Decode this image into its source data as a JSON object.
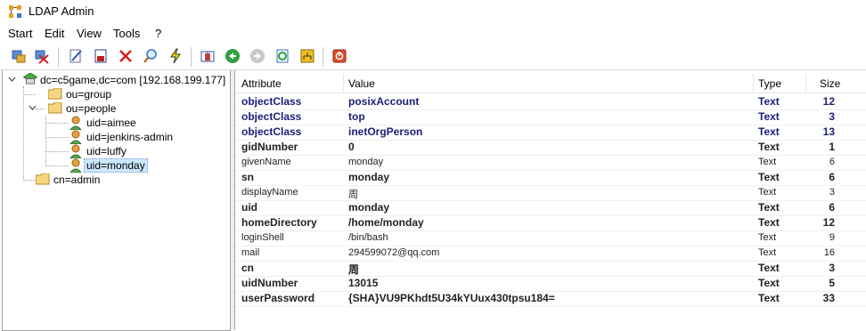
{
  "window": {
    "title": "LDAP Admin"
  },
  "menu": [
    "Start",
    "Edit",
    "View",
    "Tools",
    "?"
  ],
  "toolbar": {
    "icons": [
      "connect-icon",
      "disconnect-icon",
      "edit-entry-icon",
      "save-icon",
      "delete-icon",
      "search-icon",
      "lightning-icon",
      "book-icon",
      "back-icon",
      "forward-icon",
      "refresh-icon",
      "schema-icon",
      "exit-icon"
    ]
  },
  "tree": {
    "root": "dc=c5game,dc=com [192.168.199.177]",
    "group": "ou=group",
    "people": "ou=people",
    "users": [
      "uid=aimee",
      "uid=jenkins-admin",
      "uid=luffy",
      "uid=monday"
    ],
    "selected": "uid=monday",
    "admin": "cn=admin"
  },
  "grid": {
    "headers": {
      "attribute": "Attribute",
      "value": "Value",
      "type": "Type",
      "size": "Size"
    },
    "rows": [
      {
        "attribute": "objectClass",
        "value": "posixAccount",
        "type": "Text",
        "size": "12"
      },
      {
        "attribute": "objectClass",
        "value": "top",
        "type": "Text",
        "size": "3"
      },
      {
        "attribute": "objectClass",
        "value": "inetOrgPerson",
        "type": "Text",
        "size": "13"
      },
      {
        "attribute": "gidNumber",
        "value": "0",
        "type": "Text",
        "size": "1"
      },
      {
        "attribute": "givenName",
        "value": "monday",
        "type": "Text",
        "size": "6"
      },
      {
        "attribute": "sn",
        "value": "monday",
        "type": "Text",
        "size": "6"
      },
      {
        "attribute": "displayName",
        "value": "周",
        "type": "Text",
        "size": "3"
      },
      {
        "attribute": "uid",
        "value": "monday",
        "type": "Text",
        "size": "6"
      },
      {
        "attribute": "homeDirectory",
        "value": "/home/monday",
        "type": "Text",
        "size": "12"
      },
      {
        "attribute": "loginShell",
        "value": "/bin/bash",
        "type": "Text",
        "size": "9"
      },
      {
        "attribute": "mail",
        "value": "294599072@qq.com",
        "type": "Text",
        "size": "16"
      },
      {
        "attribute": "cn",
        "value": "周",
        "type": "Text",
        "size": "3"
      },
      {
        "attribute": "uidNumber",
        "value": "13015",
        "type": "Text",
        "size": "5"
      },
      {
        "attribute": "userPassword",
        "value": "{SHA}VU9PKhdt5U34kYUux430tpsu184=",
        "type": "Text",
        "size": "33"
      }
    ]
  }
}
